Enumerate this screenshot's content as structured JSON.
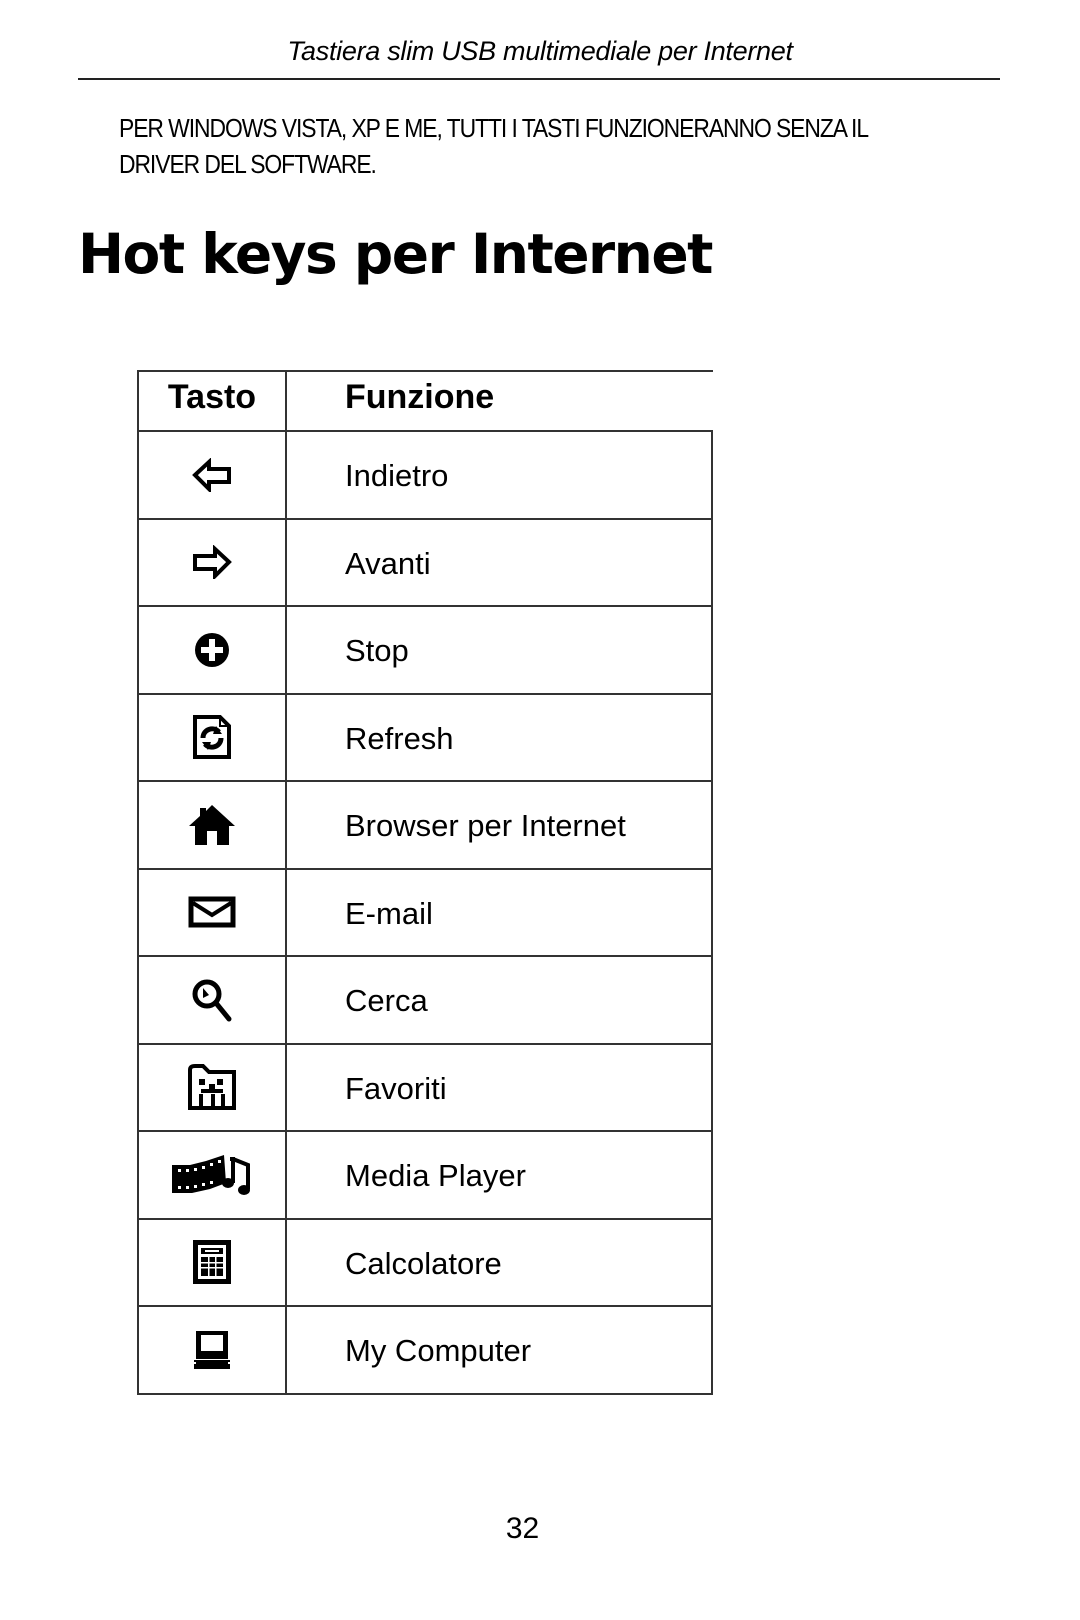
{
  "page": {
    "running_header": "Tastiera slim USB multimediale per Internet",
    "notice_line1": "PER WINDOWS VISTA,  XP  E ME,  TUTTI I TASTI FUNZIONERANNO SENZA IL",
    "notice_line2": "DRIVER DEL SOFTWARE.",
    "section_title": "Hot keys per Internet",
    "page_number": "32"
  },
  "table": {
    "headers": {
      "key": "Tasto",
      "function": "Funzione"
    },
    "rows": [
      {
        "icon": "back-arrow-icon",
        "function": "Indietro"
      },
      {
        "icon": "forward-arrow-icon",
        "function": "Avanti"
      },
      {
        "icon": "stop-icon",
        "function": "Stop"
      },
      {
        "icon": "refresh-icon",
        "function": "Refresh"
      },
      {
        "icon": "home-icon",
        "function": "Browser per Internet"
      },
      {
        "icon": "envelope-icon",
        "function": "E-mail"
      },
      {
        "icon": "search-icon",
        "function": "Cerca"
      },
      {
        "icon": "favorites-folder-icon",
        "function": "Favoriti"
      },
      {
        "icon": "media-player-icon",
        "function": "Media Player"
      },
      {
        "icon": "calculator-icon",
        "function": "Calcolatore"
      },
      {
        "icon": "computer-icon",
        "function": "My Computer"
      }
    ]
  }
}
